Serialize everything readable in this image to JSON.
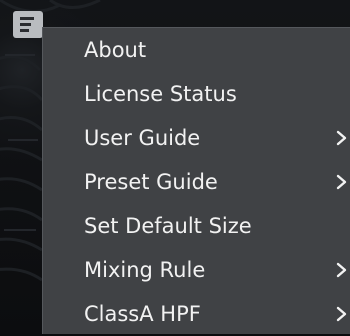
{
  "menu_button": {
    "icon": "hamburger-menu-icon"
  },
  "popup_menu": {
    "items": [
      {
        "label": "About",
        "has_submenu": false
      },
      {
        "label": "License Status",
        "has_submenu": false
      },
      {
        "label": "User Guide",
        "has_submenu": true
      },
      {
        "label": "Preset Guide",
        "has_submenu": true
      },
      {
        "label": "Set Default Size",
        "has_submenu": false
      },
      {
        "label": "Mixing Rule",
        "has_submenu": true
      },
      {
        "label": "ClassA HPF",
        "has_submenu": true
      }
    ]
  },
  "colors": {
    "menu_background": "#404245",
    "menu_text": "#f2f2f2",
    "button_background": "#b9bcc0",
    "app_background": "#0b0c0e"
  }
}
